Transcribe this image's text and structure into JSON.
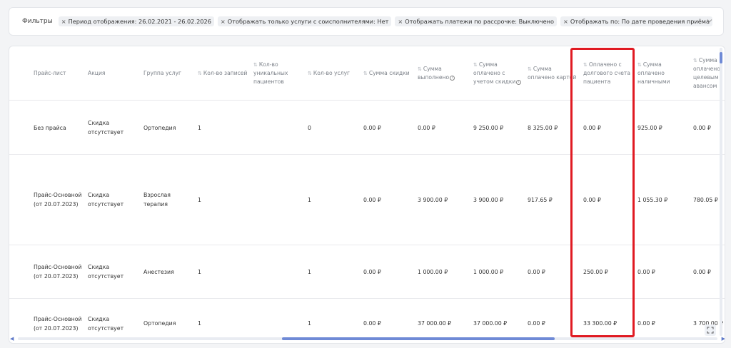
{
  "filters": {
    "label": "Фильтры",
    "chips": [
      "Период отображения: 26.02.2021 - 26.02.2026",
      "Отображать только услуги с соисполнителями: Нет",
      "Отображать платежи по рассрочке: Выключено",
      "Отображать по: По дате проведения приёма"
    ],
    "chip_remove_glyph": "×"
  },
  "table": {
    "columns": [
      {
        "label": "Прайс-лист",
        "sortable": false,
        "info": false
      },
      {
        "label": "Акция",
        "sortable": false,
        "info": false
      },
      {
        "label": "Группа услуг",
        "sortable": false,
        "info": false
      },
      {
        "label": "Кол-во записей",
        "sortable": true,
        "info": false
      },
      {
        "label": "Кол-во уникальных пациентов",
        "sortable": true,
        "info": false
      },
      {
        "label": "Кол-во услуг",
        "sortable": true,
        "info": false
      },
      {
        "label": "Сумма скидки",
        "sortable": true,
        "info": false
      },
      {
        "label": "Сумма выполнено",
        "sortable": true,
        "info": true
      },
      {
        "label": "Сумма оплачено с учетом скидки",
        "sortable": true,
        "info": true
      },
      {
        "label": "Сумма оплачено картой",
        "sortable": true,
        "info": false
      },
      {
        "label": "Оплачено с долгового счета пациента",
        "sortable": true,
        "info": false
      },
      {
        "label": "Сумма оплачено наличными",
        "sortable": true,
        "info": false
      },
      {
        "label": "Сумма оплачено целевым авансом",
        "sortable": true,
        "info": false
      }
    ],
    "sort_glyph": "⇅",
    "info_glyph": "i",
    "rows": [
      [
        "Без прайса",
        "Скидка отсутствует",
        "Ортопедия",
        "1",
        "",
        "0",
        "0.00 ₽",
        "0.00 ₽",
        "9 250.00 ₽",
        "8 325.00 ₽",
        "0.00 ₽",
        "925.00 ₽",
        "0.00 ₽"
      ],
      [
        "Прайс-Основной (от 20.07.2023)",
        "Скидка отсутствует",
        "Взрослая терапия",
        "1",
        "",
        "1",
        "0.00 ₽",
        "3 900.00 ₽",
        "3 900.00 ₽",
        "917.65 ₽",
        "0.00 ₽",
        "1 055.30 ₽",
        "780.05 ₽"
      ],
      [
        "Прайс-Основной (от 20.07.2023)",
        "Скидка отсутствует",
        "Анестезия",
        "1",
        "",
        "1",
        "0.00 ₽",
        "1 000.00 ₽",
        "1 000.00 ₽",
        "0.00 ₽",
        "250.00 ₽",
        "0.00 ₽",
        "0.00 ₽"
      ],
      [
        "Прайс-Основной (от 20.07.2023)",
        "Скидка отсутствует",
        "Ортопедия",
        "1",
        "",
        "1",
        "0.00 ₽",
        "37 000.00 ₽",
        "37 000.00 ₽",
        "0.00 ₽",
        "33 300.00 ₽",
        "0.00 ₽",
        "3 700.00 ₽"
      ]
    ],
    "highlighted_column": "Оплачено с долгового счета пациента"
  },
  "colors": {
    "highlight": "#e01a22",
    "scrollbar": "#6f8ad6",
    "header_text": "#7b8088"
  }
}
